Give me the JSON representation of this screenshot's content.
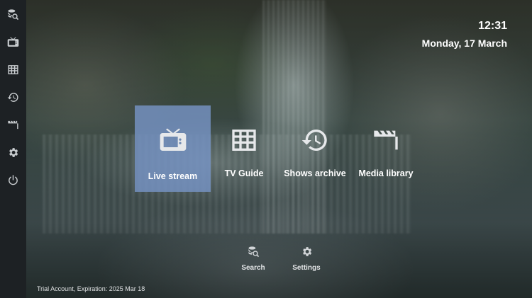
{
  "sidebar": {
    "items": [
      {
        "name": "search",
        "icon": "search-icon"
      },
      {
        "name": "live-tv",
        "icon": "tv-icon"
      },
      {
        "name": "tv-guide",
        "icon": "grid-icon"
      },
      {
        "name": "archive",
        "icon": "history-icon"
      },
      {
        "name": "media",
        "icon": "clapperboard-icon"
      },
      {
        "name": "settings",
        "icon": "gear-icon"
      },
      {
        "name": "power",
        "icon": "power-icon"
      }
    ]
  },
  "header": {
    "time": "12:31",
    "date": "Monday, 17 March"
  },
  "main": {
    "tiles": [
      {
        "label": "Live stream",
        "icon": "tv-icon",
        "selected": true
      },
      {
        "label": "TV Guide",
        "icon": "grid-icon",
        "selected": false
      },
      {
        "label": "Shows archive",
        "icon": "history-icon",
        "selected": false
      },
      {
        "label": "Media library",
        "icon": "clapperboard-icon",
        "selected": false
      }
    ],
    "accent_color": "#7694c4"
  },
  "actions": {
    "search_label": "Search",
    "settings_label": "Settings"
  },
  "footer": {
    "account_text": "Trial Account, Expiration: 2025 Mar 18"
  }
}
